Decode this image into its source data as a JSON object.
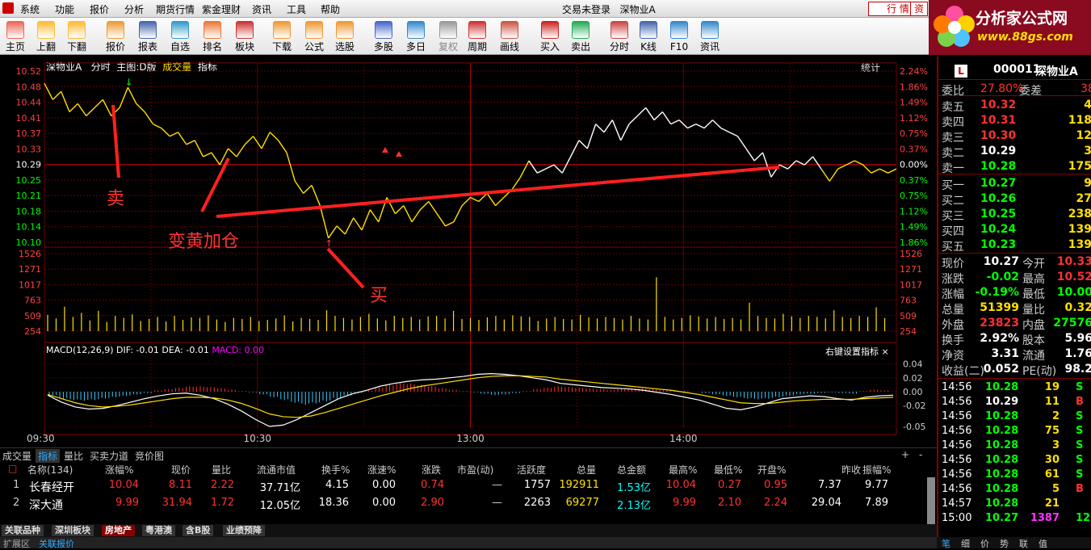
{
  "menubar": {
    "items": [
      "系统",
      "功能",
      "报价",
      "分析",
      "期货行情",
      "紫金理财",
      "资讯",
      "工具",
      "帮助"
    ],
    "title": "交易未登录",
    "stock": "深物业A",
    "mode_tab": "行 情",
    "mode_tab2": "资"
  },
  "logo": {
    "name": "分析家公式网",
    "url": "www.88gs.com"
  },
  "toolbar": [
    {
      "label": "主页",
      "icon": "home-icon"
    },
    {
      "label": "上翻",
      "icon": "up-arrow-icon"
    },
    {
      "label": "下翻",
      "icon": "down-arrow-icon"
    },
    {
      "label": "报价",
      "icon": "price-icon"
    },
    {
      "label": "报表",
      "icon": "report-icon"
    },
    {
      "label": "自选",
      "icon": "favorites-icon"
    },
    {
      "label": "排名",
      "icon": "ranking-icon"
    },
    {
      "label": "板块",
      "icon": "sector-icon"
    },
    {
      "label": "下载",
      "icon": "download-icon"
    },
    {
      "label": "公式",
      "icon": "formula-icon"
    },
    {
      "label": "选股",
      "icon": "stock-pick-icon"
    },
    {
      "label": "多股",
      "icon": "multi-stock-icon"
    },
    {
      "label": "多日",
      "icon": "multi-day-icon"
    },
    {
      "label": "复权",
      "icon": "adjust-icon",
      "disabled": true
    },
    {
      "label": "周期",
      "icon": "period-icon"
    },
    {
      "label": "画线",
      "icon": "draw-line-icon"
    },
    {
      "label": "买入",
      "icon": "buy-icon"
    },
    {
      "label": "卖出",
      "icon": "sell-icon"
    },
    {
      "label": "分时",
      "icon": "intraday-icon"
    },
    {
      "label": "K线",
      "icon": "kline-icon"
    },
    {
      "label": "F10",
      "icon": "f10-icon"
    },
    {
      "label": "资讯",
      "icon": "news-icon"
    }
  ],
  "chart_header": {
    "stock": "深物业A",
    "mode": "分时",
    "main": "主图:D版",
    "vol": "成交量",
    "ind": "指标",
    "stats": "统计"
  },
  "annotations": {
    "sell": "卖",
    "add": "变黄加仓",
    "buy": "买"
  },
  "macd_header": {
    "label": "MACD(12,26,9)",
    "dif": "DIF: -0.01",
    "dea": "DEA: -0.01",
    "macd": "MACD: 0.00",
    "right": "右键设置指标",
    "close": "×"
  },
  "chart_data": {
    "type": "line",
    "title": "",
    "price_axis_left": [
      "10.52",
      "10.48",
      "10.44",
      "10.41",
      "10.37",
      "10.33",
      "10.29",
      "10.25",
      "10.21",
      "10.18",
      "10.14",
      "10.10"
    ],
    "pct_axis_right": [
      "2.24%",
      "1.86%",
      "1.49%",
      "1.12%",
      "0.75%",
      "0.37%",
      "0.00%",
      "0.37%",
      "0.75%",
      "1.12%",
      "1.49%",
      "1.86%"
    ],
    "volume_axis": [
      "1526",
      "1271",
      "1017",
      "763",
      "509",
      "254"
    ],
    "macd_axis": [
      "0.04",
      "0.02",
      "0.00",
      "-0.02",
      "-0.05"
    ],
    "time_axis": [
      "09:30",
      "10:30",
      "13:00",
      "14:00"
    ],
    "prev_close": 10.29,
    "price_range": [
      10.1,
      10.52
    ],
    "price_series": [
      {
        "t": 0,
        "p": 10.49
      },
      {
        "t": 5,
        "p": 10.45
      },
      {
        "t": 10,
        "p": 10.47
      },
      {
        "t": 15,
        "p": 10.42
      },
      {
        "t": 20,
        "p": 10.44
      },
      {
        "t": 25,
        "p": 10.41
      },
      {
        "t": 30,
        "p": 10.43
      },
      {
        "t": 35,
        "p": 10.45
      },
      {
        "t": 40,
        "p": 10.41
      },
      {
        "t": 45,
        "p": 10.43
      },
      {
        "t": 50,
        "p": 10.48
      },
      {
        "t": 55,
        "p": 10.44
      },
      {
        "t": 60,
        "p": 10.42
      },
      {
        "t": 65,
        "p": 10.39
      },
      {
        "t": 70,
        "p": 10.38
      },
      {
        "t": 75,
        "p": 10.36
      },
      {
        "t": 80,
        "p": 10.37
      },
      {
        "t": 85,
        "p": 10.34
      },
      {
        "t": 90,
        "p": 10.35
      },
      {
        "t": 95,
        "p": 10.31
      },
      {
        "t": 100,
        "p": 10.32
      },
      {
        "t": 105,
        "p": 10.29
      },
      {
        "t": 110,
        "p": 10.33
      },
      {
        "t": 115,
        "p": 10.31
      },
      {
        "t": 120,
        "p": 10.34
      },
      {
        "t": 125,
        "p": 10.36
      },
      {
        "t": 130,
        "p": 10.33
      },
      {
        "t": 135,
        "p": 10.37
      },
      {
        "t": 140,
        "p": 10.35
      },
      {
        "t": 145,
        "p": 10.32
      },
      {
        "t": 150,
        "p": 10.25
      },
      {
        "t": 155,
        "p": 10.22
      },
      {
        "t": 160,
        "p": 10.24
      },
      {
        "t": 165,
        "p": 10.19
      },
      {
        "t": 170,
        "p": 10.11
      },
      {
        "t": 175,
        "p": 10.14
      },
      {
        "t": 180,
        "p": 10.12
      },
      {
        "t": 185,
        "p": 10.16
      },
      {
        "t": 190,
        "p": 10.13
      },
      {
        "t": 195,
        "p": 10.18
      },
      {
        "t": 200,
        "p": 10.15
      },
      {
        "t": 205,
        "p": 10.21
      },
      {
        "t": 210,
        "p": 10.17
      },
      {
        "t": 215,
        "p": 10.19
      },
      {
        "t": 220,
        "p": 10.15
      },
      {
        "t": 225,
        "p": 10.18
      },
      {
        "t": 230,
        "p": 10.2
      },
      {
        "t": 235,
        "p": 10.17
      },
      {
        "t": 240,
        "p": 10.14
      },
      {
        "t": 245,
        "p": 10.15
      },
      {
        "t": 250,
        "p": 10.19
      },
      {
        "t": 255,
        "p": 10.21
      },
      {
        "t": 260,
        "p": 10.2
      },
      {
        "t": 265,
        "p": 10.22
      },
      {
        "t": 270,
        "p": 10.19
      },
      {
        "t": 275,
        "p": 10.21
      },
      {
        "t": 280,
        "p": 10.23
      },
      {
        "t": 285,
        "p": 10.26
      },
      {
        "t": 290,
        "p": 10.3
      },
      {
        "t": 295,
        "p": 10.27
      },
      {
        "t": 300,
        "p": 10.28
      },
      {
        "t": 305,
        "p": 10.29
      },
      {
        "t": 310,
        "p": 10.27
      },
      {
        "t": 315,
        "p": 10.31
      },
      {
        "t": 320,
        "p": 10.35
      },
      {
        "t": 325,
        "p": 10.33
      },
      {
        "t": 330,
        "p": 10.39
      },
      {
        "t": 335,
        "p": 10.37
      },
      {
        "t": 340,
        "p": 10.4
      },
      {
        "t": 345,
        "p": 10.35
      },
      {
        "t": 350,
        "p": 10.39
      },
      {
        "t": 355,
        "p": 10.41
      },
      {
        "t": 360,
        "p": 10.43
      },
      {
        "t": 365,
        "p": 10.4
      },
      {
        "t": 370,
        "p": 10.42
      },
      {
        "t": 375,
        "p": 10.39
      },
      {
        "t": 380,
        "p": 10.4
      },
      {
        "t": 385,
        "p": 10.38
      },
      {
        "t": 390,
        "p": 10.39
      },
      {
        "t": 395,
        "p": 10.38
      },
      {
        "t": 400,
        "p": 10.4
      },
      {
        "t": 405,
        "p": 10.38
      },
      {
        "t": 410,
        "p": 10.37
      },
      {
        "t": 415,
        "p": 10.36
      },
      {
        "t": 420,
        "p": 10.33
      },
      {
        "t": 425,
        "p": 10.3
      },
      {
        "t": 430,
        "p": 10.32
      },
      {
        "t": 435,
        "p": 10.26
      },
      {
        "t": 440,
        "p": 10.29
      },
      {
        "t": 445,
        "p": 10.28
      },
      {
        "t": 450,
        "p": 10.3
      },
      {
        "t": 455,
        "p": 10.29
      },
      {
        "t": 460,
        "p": 10.31
      },
      {
        "t": 465,
        "p": 10.28
      },
      {
        "t": 470,
        "p": 10.25
      },
      {
        "t": 475,
        "p": 10.28
      },
      {
        "t": 480,
        "p": 10.29
      },
      {
        "t": 485,
        "p": 10.3
      },
      {
        "t": 490,
        "p": 10.29
      },
      {
        "t": 495,
        "p": 10.27
      },
      {
        "t": 500,
        "p": 10.28
      },
      {
        "t": 505,
        "p": 10.27
      },
      {
        "t": 510,
        "p": 10.28
      }
    ],
    "white_segments": [
      [
        290,
        465
      ]
    ],
    "volume_series": [
      320,
      250,
      480,
      280,
      360,
      210,
      400,
      180,
      300,
      260,
      330,
      200,
      240,
      280,
      190,
      300,
      220,
      270,
      260,
      310,
      230,
      180,
      260,
      240,
      280,
      200,
      220,
      250,
      310,
      190,
      260,
      240,
      220,
      410,
      300,
      260,
      230,
      280,
      340,
      250,
      210,
      300,
      260,
      280,
      230,
      290,
      300,
      250,
      400,
      240,
      260,
      220,
      270,
      300,
      230,
      310,
      290,
      280,
      200,
      250,
      280,
      240,
      230,
      320,
      270,
      250,
      280,
      260,
      230,
      300,
      250,
      230,
      1060,
      280,
      230,
      260,
      310,
      290,
      250,
      280,
      240,
      260,
      230,
      560,
      300,
      260,
      250,
      340,
      290,
      260,
      300,
      280,
      250,
      410,
      280,
      260,
      300,
      280,
      470,
      260
    ],
    "macd_bars": [
      -0.005,
      -0.01,
      -0.012,
      -0.013,
      -0.012,
      -0.01,
      -0.008,
      -0.006,
      -0.004,
      -0.002,
      0.002,
      0.004,
      0.006,
      0.008,
      0.008,
      0.007,
      0.005,
      0.003,
      0.001,
      -0.001,
      -0.004,
      -0.008,
      -0.012,
      -0.016,
      -0.019,
      -0.017,
      -0.014,
      -0.01,
      -0.006,
      -0.002,
      0.002,
      0.006,
      0.01,
      0.013,
      0.012,
      0.01,
      0.008,
      0.005,
      0.003,
      0.001,
      -0.001,
      -0.003,
      -0.005,
      -0.004,
      -0.002,
      0.001,
      0.004,
      0.006,
      0.008,
      0.007,
      0.006,
      0.005,
      0.004,
      0.003,
      0.004,
      0.005,
      0.005,
      0.004,
      0.003,
      0.002,
      0.001,
      0.0,
      -0.002,
      -0.004,
      -0.006,
      -0.008,
      -0.01,
      -0.011,
      -0.01,
      -0.008,
      -0.006,
      -0.004,
      -0.003,
      -0.002,
      -0.001,
      -0.002,
      -0.003,
      0.001,
      0.003,
      0.002
    ],
    "macd_dif": [
      -0.005,
      -0.015,
      -0.022,
      -0.025,
      -0.024,
      -0.02,
      -0.015,
      -0.01,
      -0.006,
      -0.003,
      -0.002,
      -0.005,
      -0.01,
      -0.018,
      -0.028,
      -0.04,
      -0.05,
      -0.048,
      -0.04,
      -0.03,
      -0.02,
      -0.01,
      -0.003,
      0.002,
      0.008,
      0.012,
      0.015,
      0.017,
      0.018,
      0.02,
      0.022,
      0.025,
      0.026,
      0.025,
      0.023,
      0.02,
      0.017,
      0.012,
      0.01,
      0.008,
      0.006,
      0.005,
      0.004,
      0.002,
      -0.001,
      -0.004,
      -0.008,
      -0.012,
      -0.018,
      -0.024,
      -0.026,
      -0.022,
      -0.016,
      -0.01,
      -0.008,
      -0.006,
      -0.007,
      -0.01,
      -0.012,
      -0.008,
      -0.006,
      -0.005
    ],
    "macd_dea": [
      -0.004,
      -0.01,
      -0.016,
      -0.02,
      -0.022,
      -0.021,
      -0.019,
      -0.016,
      -0.013,
      -0.01,
      -0.008,
      -0.008,
      -0.009,
      -0.012,
      -0.017,
      -0.024,
      -0.032,
      -0.036,
      -0.037,
      -0.035,
      -0.03,
      -0.024,
      -0.018,
      -0.012,
      -0.006,
      -0.001,
      0.004,
      0.008,
      0.011,
      0.014,
      0.017,
      0.02,
      0.022,
      0.023,
      0.023,
      0.022,
      0.021,
      0.018,
      0.016,
      0.014,
      0.012,
      0.01,
      0.008,
      0.006,
      0.004,
      0.002,
      -0.001,
      -0.004,
      -0.008,
      -0.012,
      -0.016,
      -0.017,
      -0.017,
      -0.015,
      -0.013,
      -0.012,
      -0.011,
      -0.011,
      -0.011,
      -0.01,
      -0.009,
      -0.008
    ]
  },
  "subtabs": [
    "成交量",
    "指标",
    "量比",
    "买卖力道",
    "竞价图"
  ],
  "subtab_controls": [
    "+",
    "-",
    "0"
  ],
  "table": {
    "headers": [
      "名称(134)",
      "涨幅%",
      "现价",
      "量比",
      "流通市值",
      "换手%",
      "涨速%",
      "涨跌",
      "市盈(动)",
      "活跃度",
      "总量",
      "总金额",
      "最高%",
      "最低%",
      "开盘%",
      "昨收",
      "振幅%"
    ],
    "rows": [
      [
        "1",
        "长春经开",
        "10.04",
        "8.11",
        "2.22",
        "37.71亿",
        "4.15",
        "0.00",
        "0.74",
        "—",
        "1757",
        "192911",
        "1.53亿",
        "10.04",
        "0.27",
        "0.95",
        "7.37",
        "9.77"
      ],
      [
        "2",
        "深大通",
        "9.99",
        "31.94",
        "1.72",
        "12.05亿",
        "18.36",
        "0.00",
        "2.90",
        "—",
        "2263",
        "69277",
        "2.13亿",
        "9.99",
        "2.10",
        "2.24",
        "29.04",
        "7.89"
      ]
    ]
  },
  "bottom_tabs": [
    "关联品种",
    "深圳板块",
    "房地产",
    "粤港澳",
    "含B股",
    "业绩预降"
  ],
  "status": [
    "扩展区",
    "关联报价"
  ],
  "quote": {
    "code": "000011",
    "name": "深物业A",
    "badge": "L",
    "weibi_label": "委比",
    "weibi": "27.80%",
    "weicha_label": "委差",
    "weicha": "38",
    "sells": [
      {
        "l": "卖五",
        "p": "10.32",
        "v": "4"
      },
      {
        "l": "卖四",
        "p": "10.31",
        "v": "118"
      },
      {
        "l": "卖三",
        "p": "10.30",
        "v": "12"
      },
      {
        "l": "卖二",
        "p": "10.29",
        "v": "3"
      },
      {
        "l": "卖一",
        "p": "10.28",
        "v": "175"
      }
    ],
    "buys": [
      {
        "l": "买一",
        "p": "10.27",
        "v": "9"
      },
      {
        "l": "买二",
        "p": "10.26",
        "v": "27"
      },
      {
        "l": "买三",
        "p": "10.25",
        "v": "238"
      },
      {
        "l": "买四",
        "p": "10.24",
        "v": "139"
      },
      {
        "l": "买五",
        "p": "10.23",
        "v": "139"
      }
    ],
    "stats": [
      {
        "l1": "现价",
        "v1": "10.27",
        "l2": "今开",
        "v2": "10.33"
      },
      {
        "l1": "涨跌",
        "v1": "-0.02",
        "l2": "最高",
        "v2": "10.52"
      },
      {
        "l1": "涨幅",
        "v1": "-0.19%",
        "l2": "最低",
        "v2": "10.00"
      },
      {
        "l1": "总量",
        "v1": "51399",
        "l2": "量比",
        "v2": "0.32"
      },
      {
        "l1": "外盘",
        "v1": "23823",
        "l2": "内盘",
        "v2": "27576"
      },
      {
        "l1": "换手",
        "v1": "2.92%",
        "l2": "股本",
        "v2": "5.96"
      },
      {
        "l1": "净资",
        "v1": "3.31",
        "l2": "流通",
        "v2": "1.76"
      },
      {
        "l1": "收益(二)",
        "v1": "0.052",
        "l2": "PE(动)",
        "v2": "98.2"
      }
    ],
    "ticks": [
      {
        "t": "14:56",
        "p": "10.28",
        "v": "19",
        "s": "S"
      },
      {
        "t": "14:56",
        "p": "10.29",
        "v": "11",
        "s": "B"
      },
      {
        "t": "14:56",
        "p": "10.28",
        "v": "2",
        "s": "S"
      },
      {
        "t": "14:56",
        "p": "10.28",
        "v": "75",
        "s": "S"
      },
      {
        "t": "14:56",
        "p": "10.28",
        "v": "3",
        "s": "S"
      },
      {
        "t": "14:56",
        "p": "10.28",
        "v": "30",
        "s": "S"
      },
      {
        "t": "14:56",
        "p": "10.28",
        "v": "61",
        "s": "S"
      },
      {
        "t": "14:56",
        "p": "10.28",
        "v": "5",
        "s": "B"
      },
      {
        "t": "14:57",
        "p": "10.28",
        "v": "21",
        "s": ""
      },
      {
        "t": "15:00",
        "p": "10.27",
        "v": "1387",
        "s": "12"
      }
    ],
    "tabs": [
      "笔",
      "细",
      "价",
      "势",
      "联",
      "值"
    ]
  }
}
